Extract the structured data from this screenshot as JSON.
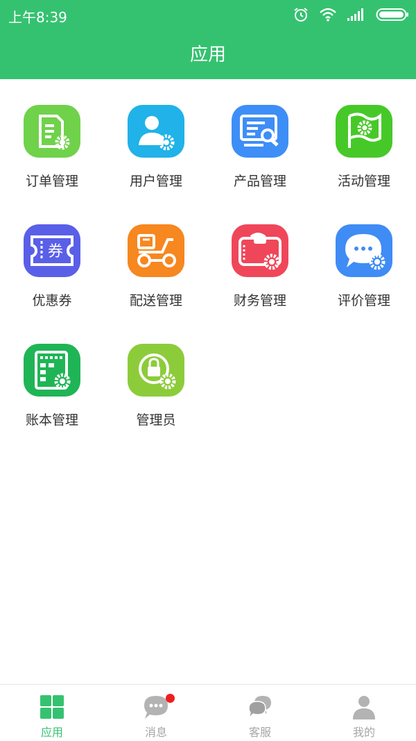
{
  "status_bar": {
    "time": "上午8:39",
    "icons": [
      "alarm-icon",
      "wifi-icon",
      "signal-icon",
      "battery-icon"
    ]
  },
  "header": {
    "title": "应用"
  },
  "apps": [
    {
      "label": "订单管理",
      "icon": "order-doc-gear-icon",
      "color": "#6fd24a"
    },
    {
      "label": "用户管理",
      "icon": "user-gear-icon",
      "color": "#20b2e8"
    },
    {
      "label": "产品管理",
      "icon": "product-search-icon",
      "color": "#3e8ef7"
    },
    {
      "label": "活动管理",
      "icon": "flag-gear-icon",
      "color": "#46c928"
    },
    {
      "label": "优惠券",
      "icon": "coupon-icon",
      "color": "#5a5fe8",
      "coupon_text": "券"
    },
    {
      "label": "配送管理",
      "icon": "scooter-icon",
      "color": "#f7871f"
    },
    {
      "label": "财务管理",
      "icon": "wallet-gear-icon",
      "color": "#f0465a"
    },
    {
      "label": "评价管理",
      "icon": "chat-gear-icon",
      "color": "#3f8cf5"
    },
    {
      "label": "账本管理",
      "icon": "ledger-gear-icon",
      "color": "#1fb556"
    },
    {
      "label": "管理员",
      "icon": "admin-lock-gear-icon",
      "color": "#8ccc3a"
    }
  ],
  "tabbar": {
    "active_color": "#35c270",
    "inactive_color": "#a6a6a6",
    "items": [
      {
        "label": "应用",
        "icon": "grid-icon",
        "active": true
      },
      {
        "label": "消息",
        "icon": "message-icon",
        "badge": true
      },
      {
        "label": "客服",
        "icon": "customer-service-icon"
      },
      {
        "label": "我的",
        "icon": "profile-icon"
      }
    ]
  }
}
